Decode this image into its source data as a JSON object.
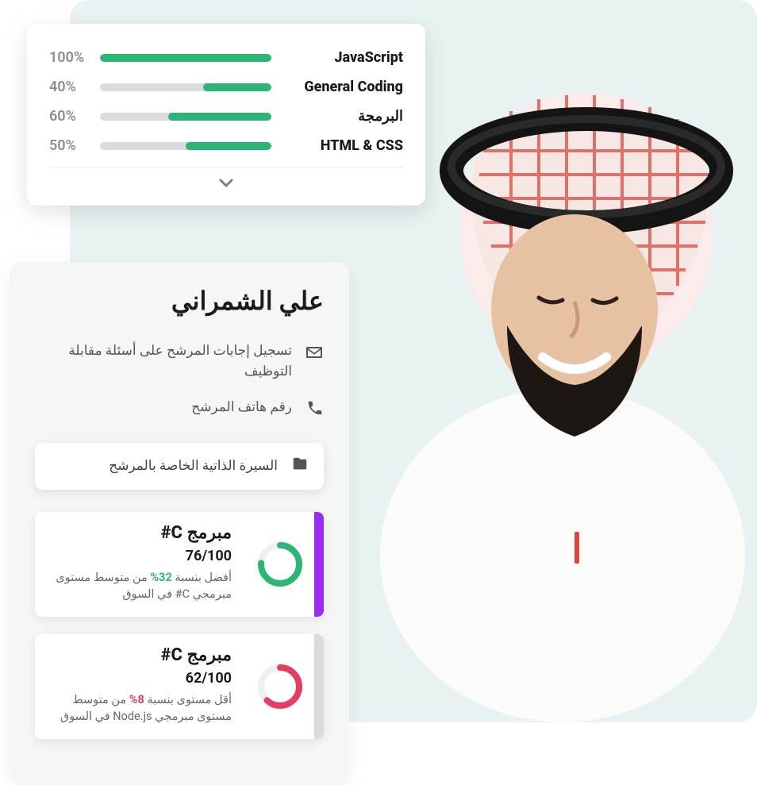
{
  "skills": {
    "items": [
      {
        "label": "JavaScript",
        "pct": 100,
        "pct_text": "100%"
      },
      {
        "label": "General Coding",
        "pct": 40,
        "pct_text": "40%"
      },
      {
        "label": "البرمجة",
        "pct": 60,
        "pct_text": "60%"
      },
      {
        "label": "HTML & CSS",
        "pct": 50,
        "pct_text": "50%"
      }
    ]
  },
  "profile": {
    "name": "علي الشمراني",
    "email_note": "تسجيل إجابات المرشح على أسئلة مقابلة التوظيف",
    "phone_note": "رقم هاتف المرشح",
    "resume_label": "السيرة الذاتية الخاصة بالمرشح"
  },
  "scores": [
    {
      "title": "مبرمج  C#",
      "value_text": "76/100",
      "ring_pct": 76,
      "ring_color": "#2bb673",
      "stripe_color": "#9b2bf2",
      "note_prefix": "أفضل بنسبة ",
      "note_highlight": "32%",
      "note_suffix": " من متوسط مستوى مبرمجي C# في السوق",
      "highlight_class": "hl-good"
    },
    {
      "title": "مبرمج  C#",
      "value_text": "62/100",
      "ring_pct": 62,
      "ring_color": "#e63e62",
      "stripe_color": "#d9dcdb",
      "note_prefix": "أقل مستوى بنسبة ",
      "note_highlight": "8%",
      "note_suffix": " من متوسط مستوى مبرمجي Node.js في السوق",
      "highlight_class": "hl-bad"
    }
  ]
}
